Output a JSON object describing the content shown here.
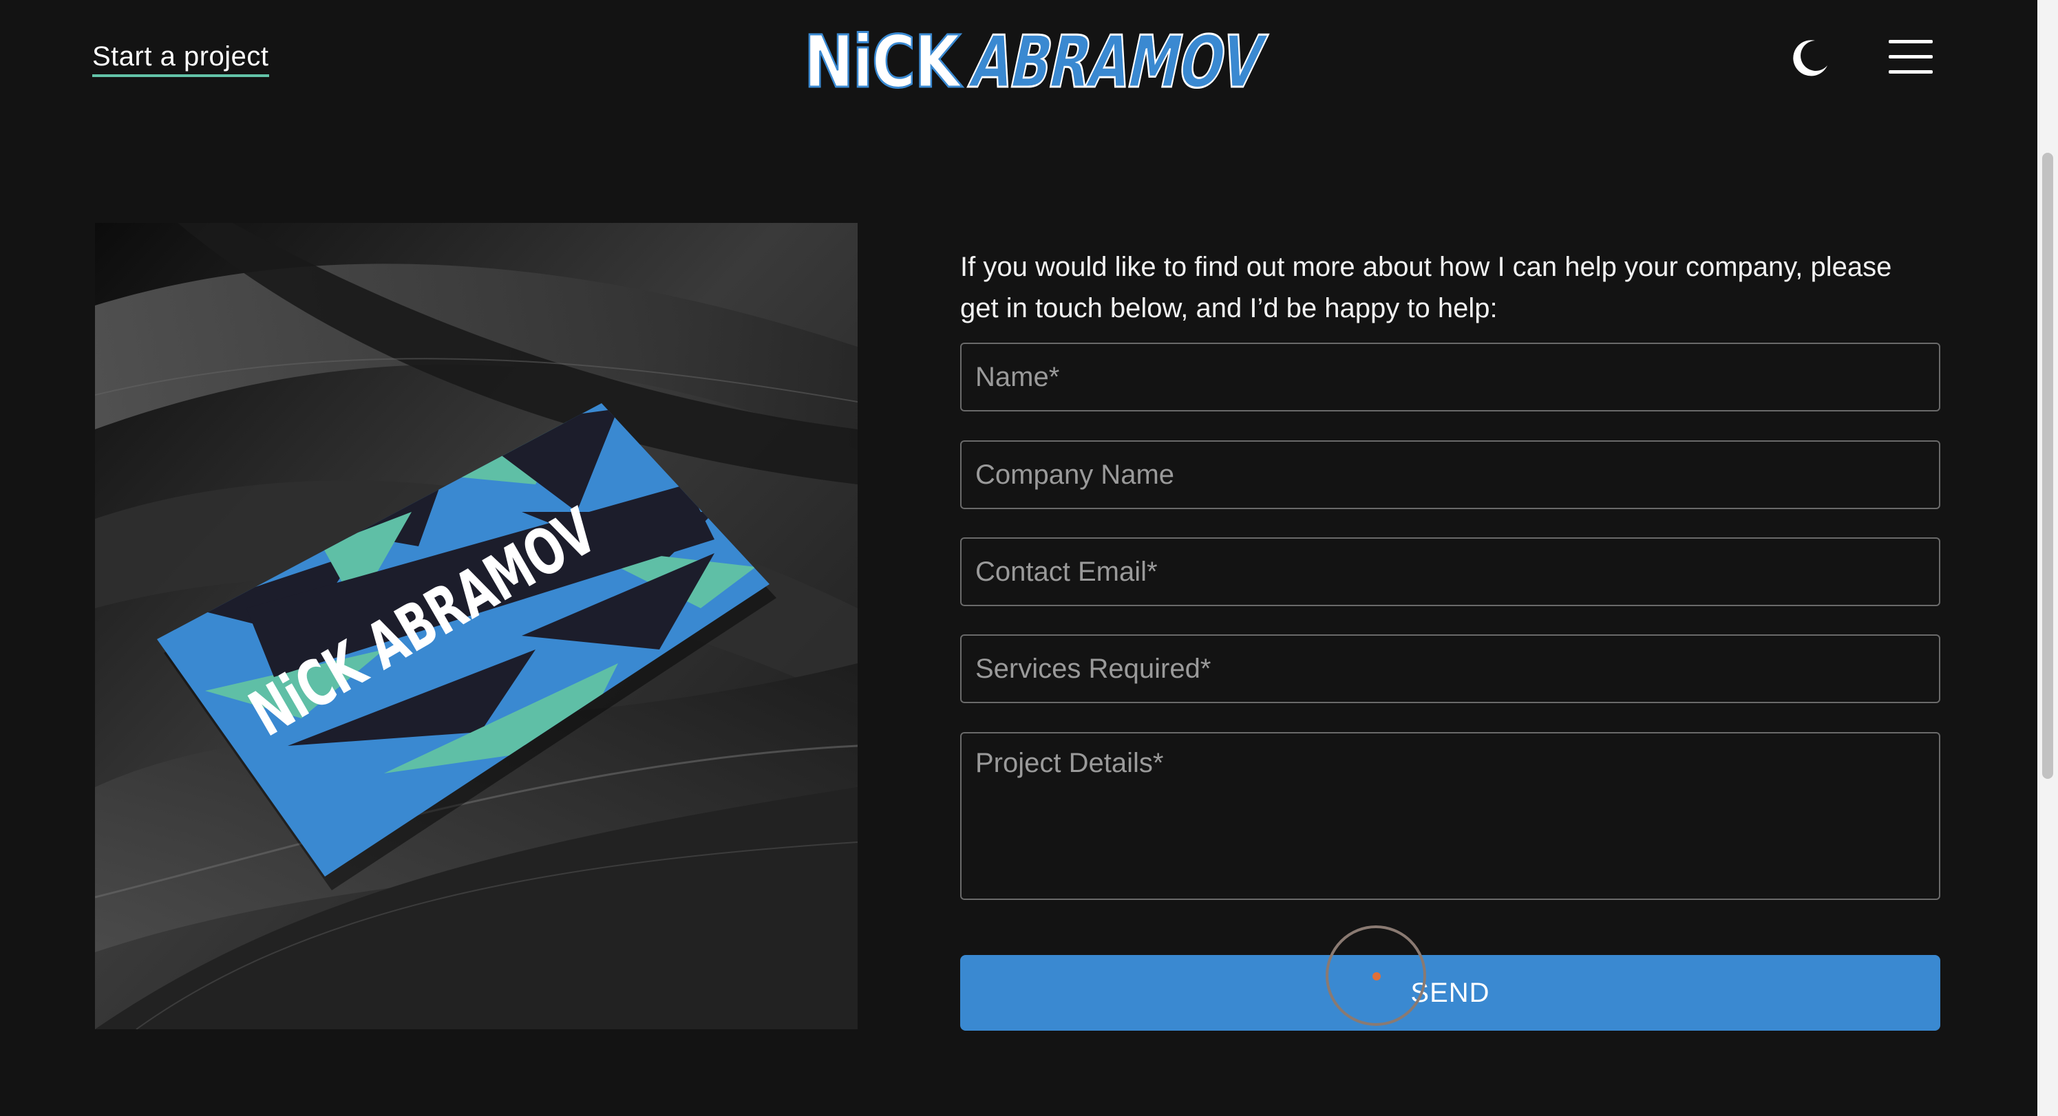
{
  "header": {
    "start_link_label": "Start a project",
    "logo_first": "NiCK",
    "logo_last": "ABRAMOV"
  },
  "image": {
    "card_text": "NiCK ABRAMOV"
  },
  "main": {
    "intro": "If you would like to find out more about how I can help your company, please get in touch below, and I’d be happy to help:"
  },
  "form": {
    "name_placeholder": "Name*",
    "company_placeholder": "Company Name",
    "email_placeholder": "Contact Email*",
    "services_placeholder": "Services Required*",
    "details_placeholder": "Project Details*",
    "send_label": "SEND"
  },
  "icons": {
    "theme": "moon-icon",
    "menu": "hamburger-menu-icon"
  },
  "colors": {
    "background": "#131313",
    "accent_blue": "#3a89d1",
    "accent_teal": "#63c3a8",
    "field_border": "#6a6a6a",
    "logo_blue": "#3a89d1"
  }
}
